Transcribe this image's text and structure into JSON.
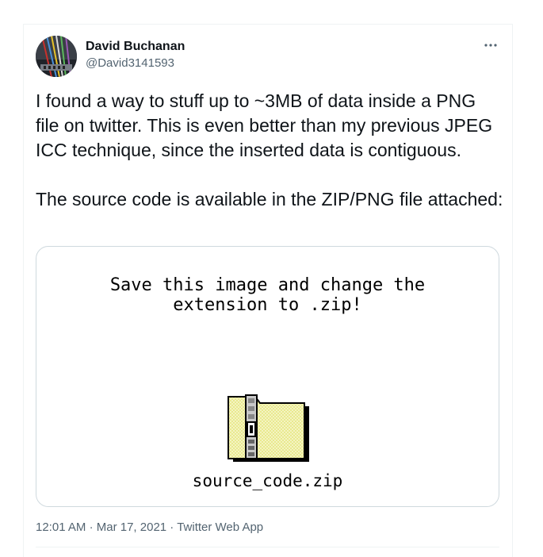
{
  "author": {
    "name": "David Buchanan",
    "handle": "@David3141593",
    "avatar_icon": "avatar-image"
  },
  "more_button": {
    "icon": "more-horizontal-icon",
    "glyph": "···"
  },
  "tweet": {
    "text_paragraph_1": "I found a way to stuff up to ~3MB of data inside a PNG file on twitter. This is even better than my previous JPEG ICC technique, since the inserted data is contiguous.",
    "text_paragraph_2": "The source code is available in the ZIP/PNG file attached:"
  },
  "media": {
    "caption_line_1": "Save this image and change the",
    "caption_line_2": "extension to .zip!",
    "file_icon": "zip-file-icon",
    "file_name": "source_code.zip"
  },
  "meta": {
    "time": "12:01 AM",
    "separator": "·",
    "date": "Mar 17, 2021",
    "app": "Twitter Web App"
  },
  "colors": {
    "text_primary": "#0f1419",
    "text_secondary": "#536471",
    "border": "#cfd9de",
    "folder_fill": "#e9e98f"
  }
}
